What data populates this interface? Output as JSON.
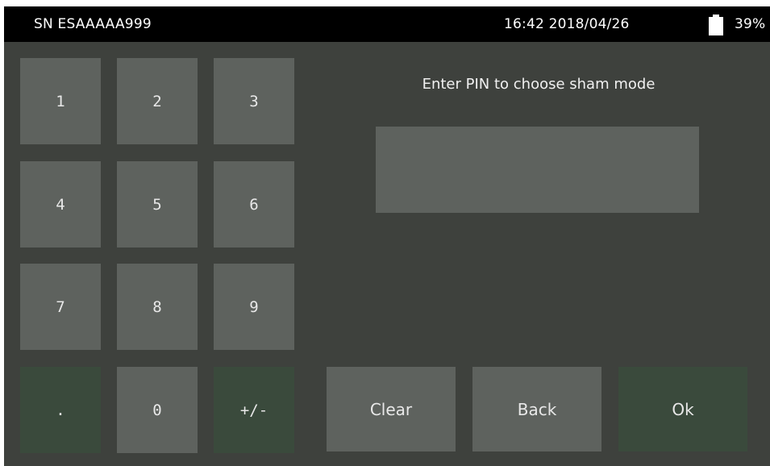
{
  "status_bar": {
    "serial": "SN ESAAAAA999",
    "datetime": "16:42 2018/04/26",
    "battery_icon": "battery-icon",
    "battery_percent": "39%"
  },
  "prompt": "Enter PIN to choose sham mode",
  "pin_field": {
    "value": ""
  },
  "keypad": {
    "keys": [
      "1",
      "2",
      "3",
      "4",
      "5",
      "6",
      "7",
      "8",
      "9",
      ".",
      "0",
      "+/-"
    ]
  },
  "actions": {
    "clear": "Clear",
    "back": "Back",
    "ok": "Ok"
  },
  "colors": {
    "background": "#3e413d",
    "key": "#5e625e",
    "key_disabled": "#3a4a3c",
    "status_bar": "#000000",
    "text": "#e8e8e8"
  }
}
